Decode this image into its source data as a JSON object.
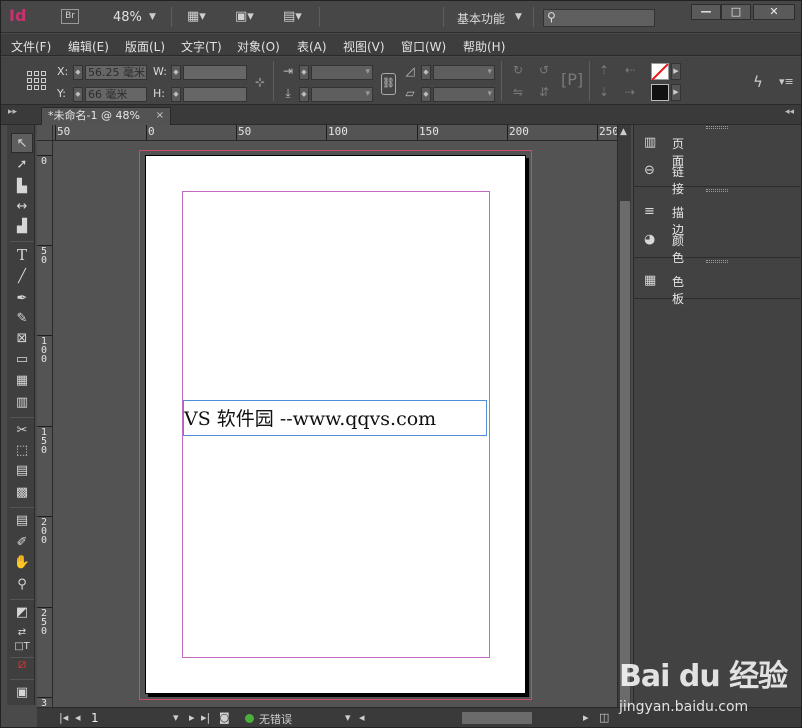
{
  "titlebar": {
    "logo": "Id",
    "bridge": "Br",
    "zoom": "48%",
    "workspace": "基本功能",
    "search_placeholder": "",
    "minimize": "—",
    "maximize": "□",
    "close": "✕"
  },
  "menu": [
    "文件(F)",
    "编辑(E)",
    "版面(L)",
    "文字(T)",
    "对象(O)",
    "表(A)",
    "视图(V)",
    "窗口(W)",
    "帮助(H)"
  ],
  "control": {
    "x_label": "X:",
    "x_value": "56.25 毫米",
    "y_label": "Y:",
    "y_value": "66 毫米",
    "w_label": "W:",
    "h_label": "H:"
  },
  "document_tab": {
    "title": "*未命名-1 @ 48%",
    "close": "×"
  },
  "ruler_h": [
    "50",
    "0",
    "50",
    "100",
    "150",
    "200",
    "250"
  ],
  "ruler_v": [
    [
      "0"
    ],
    [
      "5",
      "0"
    ],
    [
      "1",
      "0",
      "0"
    ],
    [
      "1",
      "5",
      "0"
    ],
    [
      "2",
      "0",
      "0"
    ],
    [
      "2",
      "5",
      "0"
    ],
    [
      "3"
    ]
  ],
  "page_text": "VS 软件园 --www.qqvs.com",
  "panels": [
    {
      "icon": "pages-icon",
      "glyph": "▥",
      "label": "页面"
    },
    {
      "icon": "links-icon",
      "glyph": "⊖",
      "label": "链接"
    },
    {
      "icon": "stroke-icon",
      "glyph": "≡",
      "label": "描边"
    },
    {
      "icon": "color-icon",
      "glyph": "◕",
      "label": "颜色"
    },
    {
      "icon": "swatches-icon",
      "glyph": "▦",
      "label": "色板"
    }
  ],
  "status": {
    "page": "1",
    "preflight": "无错误"
  },
  "watermark": {
    "main": "Bai du 经验",
    "sub": "jingyan.baidu.com"
  }
}
